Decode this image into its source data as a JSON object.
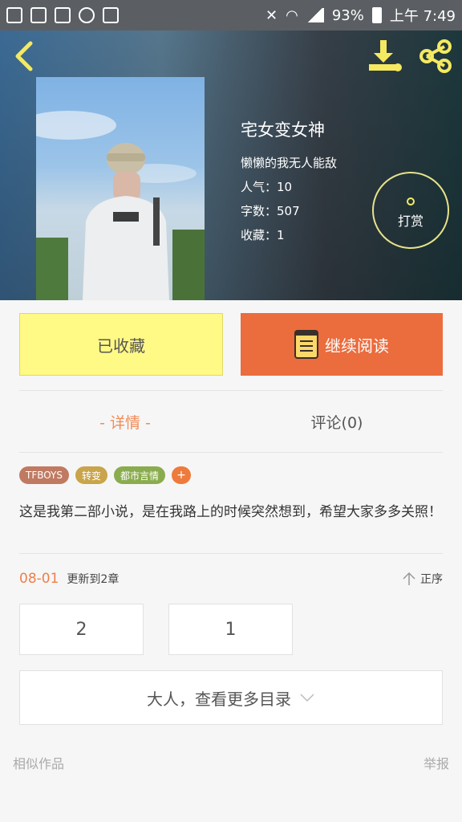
{
  "status_bar": {
    "battery": "93%",
    "time": "上午 7:49"
  },
  "header": {
    "back_icon": "chevron-left-icon",
    "download_icon": "download-icon",
    "share_icon": "share-icon"
  },
  "book": {
    "title": "宅女变女神",
    "author": "懒懒的我无人能敌",
    "popularity": "人气：10",
    "word_count": "字数：507",
    "favorites": "收藏：1",
    "tip_label": "打赏"
  },
  "actions": {
    "favorite_label": "已收藏",
    "read_label": "继续阅读"
  },
  "tabs": [
    {
      "label": "- 详情 -",
      "active": true
    },
    {
      "label": "评论(0)",
      "active": false
    }
  ],
  "tags": [
    {
      "label": "TFBOYS",
      "color": "#c07a62"
    },
    {
      "label": "转变",
      "color": "#c9a44a"
    },
    {
      "label": "都市言情",
      "color": "#8aac4e"
    },
    {
      "label": "+",
      "color": "#ee7a3c"
    }
  ],
  "description": "这是我第二部小说，是在我路上的时候突然想到，希望大家多多关照！",
  "update": {
    "date": "08-01",
    "text": "更新到2章",
    "sort_label": "正序"
  },
  "chapters": [
    "2",
    "1"
  ],
  "more_label": "大人，查看更多目录",
  "footer": {
    "similar": "相似作品",
    "report": "举报"
  },
  "colors": {
    "accent_orange": "#eb6c3d",
    "fav_yellow": "#fff985",
    "active_tab": "#f18b57"
  }
}
